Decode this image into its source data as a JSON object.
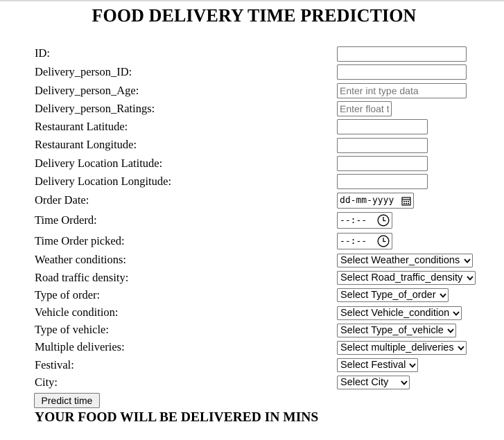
{
  "title": "FOOD DELIVERY TIME PREDICTION",
  "fields": {
    "id": {
      "label": "ID:",
      "value": "",
      "placeholder": ""
    },
    "delivery_person_id": {
      "label": "Delivery_person_ID:",
      "value": "",
      "placeholder": ""
    },
    "delivery_person_age": {
      "label": "Delivery_person_Age:",
      "value": "",
      "placeholder": "Enter int type data"
    },
    "delivery_person_ratings": {
      "label": "Delivery_person_Ratings:",
      "value": "",
      "placeholder": "Enter float type data"
    },
    "restaurant_latitude": {
      "label": "Restaurant Latitude:",
      "value": "",
      "placeholder": ""
    },
    "restaurant_longitude": {
      "label": "Restaurant Longitude:",
      "value": "",
      "placeholder": ""
    },
    "delivery_location_latitude": {
      "label": "Delivery Location Latitude:",
      "value": "",
      "placeholder": ""
    },
    "delivery_location_longitude": {
      "label": "Delivery Location Longitude:",
      "value": "",
      "placeholder": ""
    },
    "order_date": {
      "label": "Order Date:",
      "display": "dd-mm-yyyy",
      "icon": "calendar-icon"
    },
    "time_orderd": {
      "label": "Time Orderd:",
      "display": "--:--",
      "icon": "clock-icon"
    },
    "time_order_picked": {
      "label": "Time Order picked:",
      "display": "--:--",
      "icon": "clock-icon"
    },
    "weather_conditions": {
      "label": "Weather conditions:",
      "selected": "Select Weather_conditions"
    },
    "road_traffic_density": {
      "label": "Road traffic density:",
      "selected": "Select Road_traffic_density"
    },
    "type_of_order": {
      "label": "Type of order:",
      "selected": "Select Type_of_order"
    },
    "vehicle_condition": {
      "label": "Vehicle condition:",
      "selected": "Select Vehicle_condition"
    },
    "type_of_vehicle": {
      "label": "Type of vehicle:",
      "selected": "Select Type_of_vehicle"
    },
    "multiple_deliveries": {
      "label": "Multiple deliveries:",
      "selected": "Select multiple_deliveries"
    },
    "festival": {
      "label": "Festival:",
      "selected": "Select Festival"
    },
    "city": {
      "label": "City:",
      "selected": "Select City"
    }
  },
  "predict_button": "Predict time",
  "result_text": "YOUR FOOD WILL BE DELIVERED IN MINS"
}
